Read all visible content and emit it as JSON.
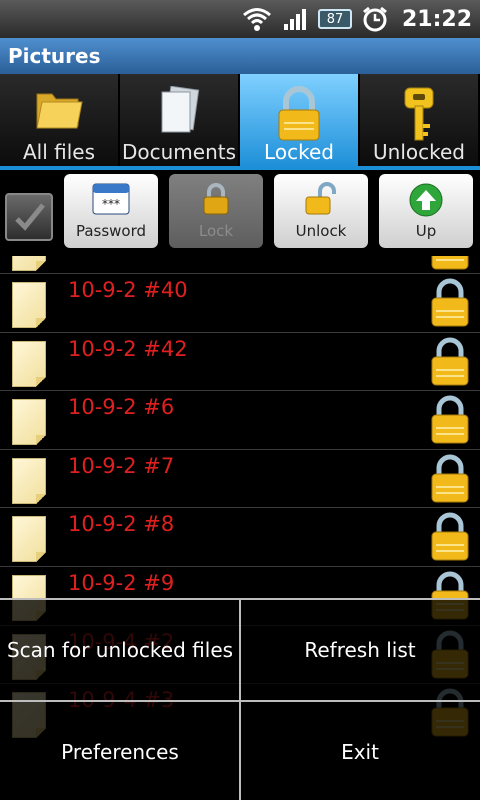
{
  "status_bar": {
    "battery_level": "87",
    "time": "21:22"
  },
  "title_bar": {
    "title": "Pictures"
  },
  "tabs": [
    {
      "label": "All files",
      "icon": "folder-icon",
      "active": false
    },
    {
      "label": "Documents",
      "icon": "documents-icon",
      "active": false
    },
    {
      "label": "Locked",
      "icon": "lock-icon",
      "active": true
    },
    {
      "label": "Unlocked",
      "icon": "key-icon",
      "active": false
    }
  ],
  "toolbar": {
    "password_label": "Password",
    "lock_label": "Lock",
    "unlock_label": "Unlock",
    "up_label": "Up"
  },
  "files": [
    {
      "name": ""
    },
    {
      "name": "10-9-2 #40"
    },
    {
      "name": "10-9-2 #42"
    },
    {
      "name": "10-9-2 #6"
    },
    {
      "name": "10-9-2 #7"
    },
    {
      "name": "10-9-2 #8"
    },
    {
      "name": "10-9-2 #9"
    },
    {
      "name": "10-9-4 #2"
    },
    {
      "name": "10-9-4 #3"
    }
  ],
  "options_menu": {
    "scan_label": "Scan for unlocked files",
    "refresh_label": "Refresh list",
    "preferences_label": "Preferences",
    "exit_label": "Exit"
  },
  "colors": {
    "accent": "#1d8fd8",
    "file_name": "#e02020",
    "title_bar": "#2b5f98"
  }
}
